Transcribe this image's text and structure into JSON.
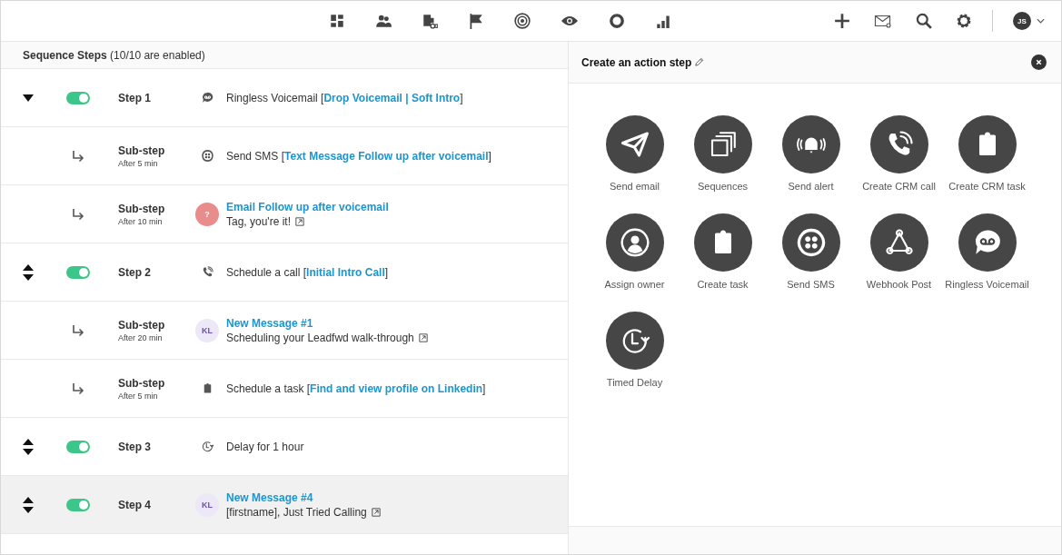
{
  "topbar": {
    "user_initials": "JS"
  },
  "sequence": {
    "heading": "**Sequence Steps** (10/10 are enabled)",
    "rows": [
      {
        "kind": "step",
        "label": "Step 1",
        "expanded": true,
        "enabled": true,
        "highlighted": false,
        "action": "Ringless Voicemail [",
        "link": "Drop Voicemail | Soft Intro",
        "close": "]"
      },
      {
        "kind": "substep",
        "label": "Sub-step",
        "delay": "After 5 min",
        "highlighted": false,
        "action": "Send SMS [",
        "link": "Text Message Follow up after voicemail",
        "close": "]"
      },
      {
        "kind": "substep",
        "label": "Sub-step",
        "delay": "After 10 min",
        "highlighted": false,
        "avatar": {
          "initials": "?",
          "color": "#e98c8c"
        },
        "title": "Email Follow up after voicemail",
        "subtitle": "Tag, you're it!"
      },
      {
        "kind": "step",
        "label": "Step 2",
        "expanded": false,
        "enabled": true,
        "highlighted": false,
        "action": "Schedule a call [",
        "link": "Initial Intro Call",
        "close": "]"
      },
      {
        "kind": "substep",
        "label": "Sub-step",
        "delay": "After 20 min",
        "highlighted": false,
        "avatar": {
          "initials": "KL",
          "color": "#ece8f8"
        },
        "title": "New Message #1",
        "subtitle": "Scheduling your Leadfwd walk-through"
      },
      {
        "kind": "substep",
        "label": "Sub-step",
        "delay": "After 5 min",
        "highlighted": false,
        "action": "Schedule a task [",
        "link": "Find and view profile on Linkedin",
        "close": "]"
      },
      {
        "kind": "step",
        "label": "Step 3",
        "expanded": false,
        "enabled": true,
        "highlighted": false,
        "action": "Delay for 1 hour"
      },
      {
        "kind": "step",
        "label": "Step 4",
        "expanded": false,
        "enabled": true,
        "highlighted": true,
        "avatar": {
          "initials": "KL",
          "color": "#ece8f8"
        },
        "title": "New Message #4",
        "subtitle": "[firstname], Just Tried Calling"
      }
    ]
  },
  "action_panel": {
    "title": "Create an action step",
    "actions": [
      {
        "label": "Send email"
      },
      {
        "label": "Sequences"
      },
      {
        "label": "Send alert"
      },
      {
        "label": "Create CRM call"
      },
      {
        "label": "Create CRM task"
      },
      {
        "label": "Assign owner"
      },
      {
        "label": "Create task"
      },
      {
        "label": "Send SMS"
      },
      {
        "label": "Webhook Post"
      },
      {
        "label": "Ringless Voicemail"
      },
      {
        "label": "Timed Delay"
      }
    ]
  }
}
